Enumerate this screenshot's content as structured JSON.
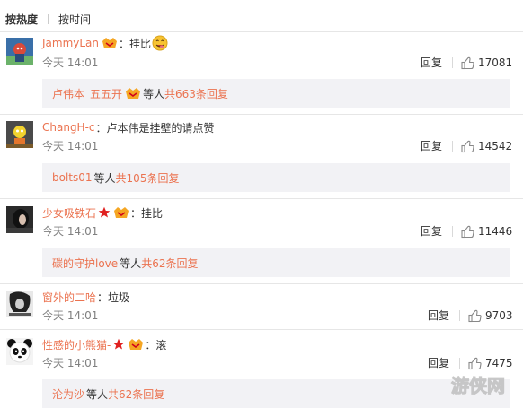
{
  "sort": {
    "hot": "按热度",
    "time": "按时间"
  },
  "comments": [
    {
      "user": "JammyLan",
      "text": "挂比",
      "time": "今天 14:01",
      "reply": "回复",
      "likes": "17081",
      "replies": {
        "user": "卢伟本_五五开",
        "mid": "等人",
        "count": "共663条回复"
      }
    },
    {
      "user": "ChangH-c",
      "text": "卢本伟是挂壁的请点赞",
      "time": "今天 14:01",
      "reply": "回复",
      "likes": "14542",
      "replies": {
        "user": "bolts01",
        "mid": "等人",
        "count": "共105条回复"
      }
    },
    {
      "user": "少女吸铁石",
      "text": "挂比",
      "time": "今天 14:01",
      "reply": "回复",
      "likes": "11446",
      "replies": {
        "user": "碳的守护love",
        "mid": "等人",
        "count": "共62条回复"
      }
    },
    {
      "user": "窗外的二哈",
      "text": "垃圾",
      "time": "今天 14:01",
      "reply": "回复",
      "likes": "9703"
    },
    {
      "user": "性感的小熊猫-",
      "text": "滚",
      "time": "今天 14:01",
      "reply": "回复",
      "likes": "7475",
      "replies": {
        "user": "沦为沙",
        "mid": "等人",
        "count": "共62条回复"
      }
    }
  ],
  "colon": "：",
  "watermark": "游侠网",
  "colors": {
    "accent": "#eb7350",
    "reply_bg": "#f2f2f5",
    "star": "#e02020",
    "vip_gold": "#f5a623"
  }
}
